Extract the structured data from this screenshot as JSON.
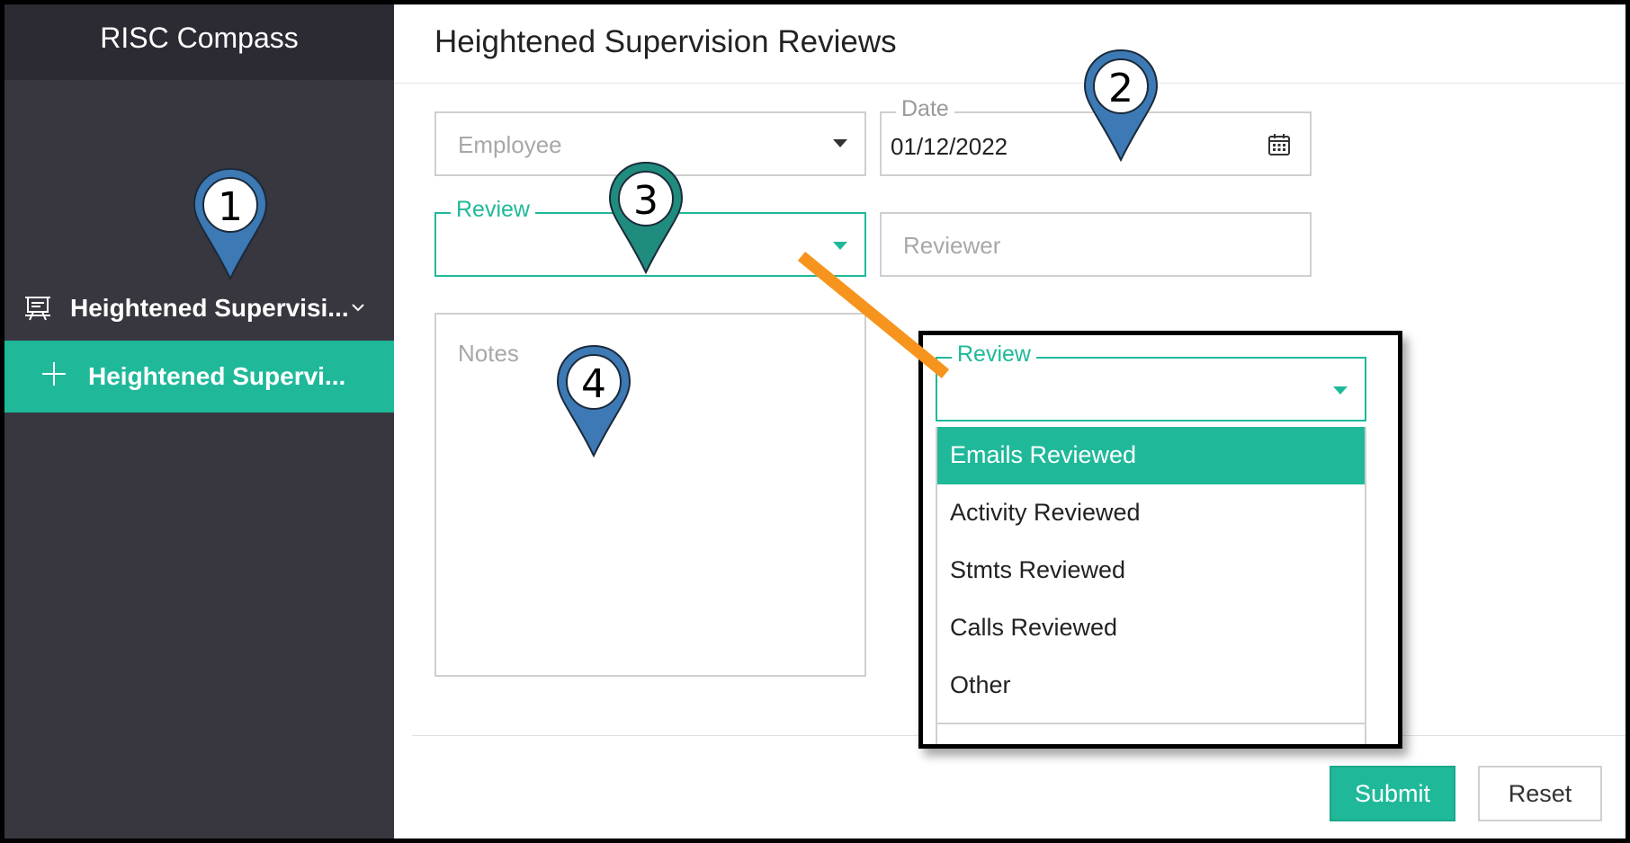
{
  "app": {
    "brand": "RISC Compass"
  },
  "sidebar": {
    "group": {
      "label": "Heightened Supervisi...",
      "icon": "presentation-board-icon",
      "chevron": "chevron-down-icon"
    },
    "items": [
      {
        "label": "Heightened Supervi...",
        "icon": "plus-icon",
        "active": true
      }
    ]
  },
  "main": {
    "title": "Heightened Supervision Reviews",
    "form": {
      "employee": {
        "placeholder": "Employee"
      },
      "date": {
        "label": "Date",
        "value": "01/12/2022",
        "icon": "calendar-icon"
      },
      "review": {
        "label": "Review",
        "value": ""
      },
      "reviewer": {
        "placeholder": "Reviewer"
      },
      "notes": {
        "placeholder": "Notes"
      }
    },
    "buttons": {
      "submit": "Submit",
      "reset": "Reset"
    }
  },
  "callout": {
    "review": {
      "label": "Review"
    },
    "options": [
      "Emails Reviewed",
      "Activity Reviewed",
      "Stmts Reviewed",
      "Calls Reviewed",
      "Other"
    ],
    "selected": "Emails Reviewed"
  },
  "markers": [
    "1",
    "2",
    "3",
    "4"
  ],
  "colors": {
    "accent": "#1fb99a",
    "sidebar": "#383740",
    "header": "#2c2b33",
    "pin_blue": "#3d79b4",
    "pin_teal": "#1f8c7e",
    "connector": "#f7941d"
  }
}
